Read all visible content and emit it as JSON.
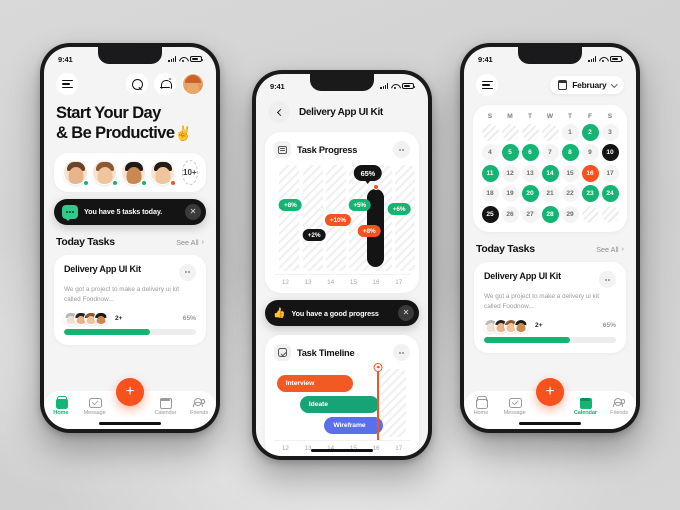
{
  "background": {
    "base_color": "#d4d4d4"
  },
  "colors": {
    "green": "#14b573",
    "orange": "#f7511d",
    "dark": "#141414",
    "blue": "#5b6fe8",
    "muted": "#9a9a9a"
  },
  "phone1": {
    "status": {
      "time": "9:41"
    },
    "header": {
      "menu_icon": "hamburger-icon",
      "search_icon": "search-icon",
      "bell_icon": "bell-icon",
      "avatar_icon": "avatar-icon"
    },
    "headline_line1": "Start Your Day",
    "headline_line2": "& Be Productive",
    "headline_emoji": "✌️",
    "avatars": [
      {
        "status": "online",
        "skin": "#e7b48c",
        "hair": "#6a4328"
      },
      {
        "status": "online",
        "skin": "#f0c49c",
        "hair": "#8a5a33"
      },
      {
        "status": "online",
        "skin": "#c98a52",
        "hair": "#1f1a17"
      },
      {
        "status": "busy",
        "skin": "#f0c49c",
        "hair": "#241c18"
      }
    ],
    "avatar_more": "10+",
    "toast": {
      "icon": "chat-bubble-icon",
      "text": "You have 5 tasks today.",
      "close": "✕"
    },
    "section": {
      "title": "Today Tasks",
      "link": "See All",
      "chevron": "›"
    },
    "task_card": {
      "title": "Delivery App UI Kit",
      "description": "We got a project to make a delivery ui kit called Foodnow...",
      "members_more": "2+",
      "progress_label": "65%",
      "progress_value": 65
    },
    "tabs": [
      {
        "label": "Home",
        "icon": "home-icon",
        "active": true
      },
      {
        "label": "Message",
        "icon": "message-icon",
        "active": false
      },
      {
        "label": "Calendar",
        "icon": "calendar-icon",
        "active": false
      },
      {
        "label": "Friends",
        "icon": "friends-icon",
        "active": false
      }
    ],
    "fab": {
      "label": "+",
      "icon": "plus-icon"
    }
  },
  "phone2": {
    "status": {
      "time": "9:41"
    },
    "header": {
      "back_icon": "chevron-left-icon",
      "title": "Delivery App UI Kit"
    },
    "progress_panel": {
      "icon": "task-list-icon",
      "title": "Task Progress",
      "more": "more-icon"
    },
    "chart_data": {
      "type": "bar",
      "title": "Task Progress",
      "categories": [
        "12",
        "13",
        "14",
        "15",
        "16",
        "17"
      ],
      "xlabel": "",
      "ylabel": "",
      "tooltip": "65%",
      "selected_category": "16",
      "badges": [
        {
          "category": "12",
          "label": "+8%",
          "value": 8,
          "color": "green",
          "y": 40
        },
        {
          "category": "13",
          "label": "+2%",
          "value": 2,
          "color": "dark",
          "y": 68
        },
        {
          "category": "14",
          "label": "+10%",
          "value": 10,
          "color": "orange",
          "y": 52
        },
        {
          "category": "15",
          "label": "+5%",
          "value": 5,
          "color": "green",
          "y": 38
        },
        {
          "category": "16",
          "label": "+8%",
          "value": 8,
          "color": "orange",
          "y": 60
        },
        {
          "category": "17",
          "label": "+6%",
          "value": 6,
          "color": "green",
          "y": 44
        }
      ]
    },
    "toast": {
      "emoji": "👍",
      "text": "You have a good progress",
      "close": "✕"
    },
    "timeline_panel": {
      "icon": "clock-check-icon",
      "title": "Task Timeline",
      "more": "more-icon"
    },
    "timeline_data": {
      "type": "bar",
      "title": "Task Timeline",
      "categories": [
        "12",
        "13",
        "14",
        "15",
        "16",
        "17"
      ],
      "marker_category": "16",
      "tasks": [
        {
          "name": "Interview",
          "start": "12",
          "end": "15",
          "color": "#f25a24"
        },
        {
          "name": "Ideate",
          "start": "13",
          "end": "16",
          "color": "#16a375"
        },
        {
          "name": "Wireframe",
          "start": "14",
          "end": "16.2",
          "color": "#5b6fe8"
        }
      ]
    }
  },
  "phone3": {
    "status": {
      "time": "9:41"
    },
    "header": {
      "menu_icon": "hamburger-icon",
      "calendar_icon": "calendar-icon",
      "month": "February",
      "chevron": "chevron-down-icon"
    },
    "calendar": {
      "weekdays": [
        "S",
        "M",
        "T",
        "W",
        "T",
        "F",
        "S"
      ],
      "leading_blanks": 4,
      "days": [
        {
          "n": "1",
          "state": "default"
        },
        {
          "n": "2",
          "state": "green"
        },
        {
          "n": "3",
          "state": "default"
        },
        {
          "n": "4",
          "state": "default"
        },
        {
          "n": "5",
          "state": "green"
        },
        {
          "n": "6",
          "state": "green"
        },
        {
          "n": "7",
          "state": "default"
        },
        {
          "n": "8",
          "state": "green"
        },
        {
          "n": "9",
          "state": "default"
        },
        {
          "n": "10",
          "state": "black"
        },
        {
          "n": "11",
          "state": "green"
        },
        {
          "n": "12",
          "state": "default"
        },
        {
          "n": "13",
          "state": "default"
        },
        {
          "n": "14",
          "state": "green"
        },
        {
          "n": "15",
          "state": "default"
        },
        {
          "n": "16",
          "state": "orange"
        },
        {
          "n": "17",
          "state": "default"
        },
        {
          "n": "18",
          "state": "default"
        },
        {
          "n": "19",
          "state": "default"
        },
        {
          "n": "20",
          "state": "green"
        },
        {
          "n": "21",
          "state": "default"
        },
        {
          "n": "22",
          "state": "default"
        },
        {
          "n": "23",
          "state": "green"
        },
        {
          "n": "24",
          "state": "green"
        },
        {
          "n": "25",
          "state": "black"
        },
        {
          "n": "26",
          "state": "default"
        },
        {
          "n": "27",
          "state": "default"
        },
        {
          "n": "28",
          "state": "green"
        },
        {
          "n": "29",
          "state": "default"
        }
      ],
      "trailing_blanks": 2
    },
    "section": {
      "title": "Today Tasks",
      "link": "See All",
      "chevron": "›"
    },
    "task_card": {
      "title": "Delivery App UI Kit",
      "description": "We got a project to make a delivery ui kit called Foodnow...",
      "members_more": "2+",
      "progress_label": "65%",
      "progress_value": 65
    },
    "tabs": [
      {
        "label": "Home",
        "icon": "home-icon",
        "active": false
      },
      {
        "label": "Message",
        "icon": "message-icon",
        "active": false
      },
      {
        "label": "Calendar",
        "icon": "calendar-icon",
        "active": true
      },
      {
        "label": "Friends",
        "icon": "friends-icon",
        "active": false
      }
    ],
    "fab": {
      "label": "+",
      "icon": "plus-icon"
    }
  }
}
